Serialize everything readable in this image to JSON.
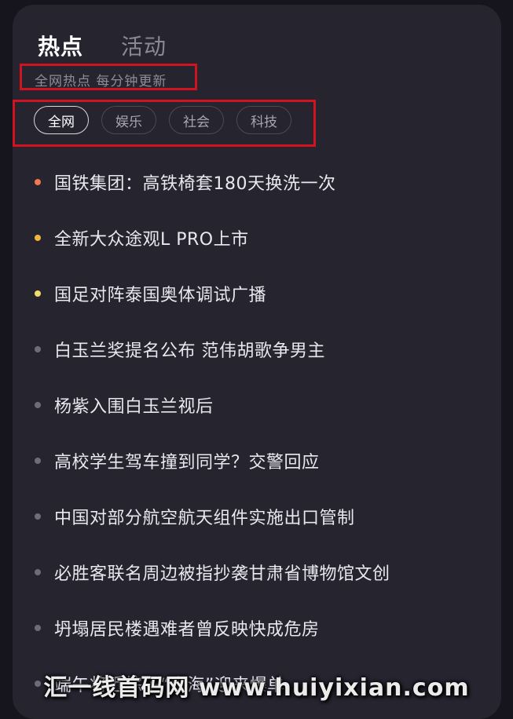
{
  "tabs": [
    {
      "label": "热点",
      "active": true
    },
    {
      "label": "活动",
      "active": false
    }
  ],
  "subtitle": "全网热点 每分钟更新",
  "chips": [
    {
      "label": "全网",
      "active": true
    },
    {
      "label": "娱乐",
      "active": false
    },
    {
      "label": "社会",
      "active": false
    },
    {
      "label": "科技",
      "active": false
    }
  ],
  "items": [
    {
      "text": "国铁集团：高铁椅套180天换洗一次",
      "dot_color": "#ef7a4f"
    },
    {
      "text": "全新大众途观L PRO上市",
      "dot_color": "#f2b33a"
    },
    {
      "text": "国足对阵泰国奥体调试广播",
      "dot_color": "#f1dc6a"
    },
    {
      "text": "白玉兰奖提名公布 范伟胡歌争男主",
      "dot_color": "#6e6c78"
    },
    {
      "text": "杨紫入围白玉兰视后",
      "dot_color": "#6e6c78"
    },
    {
      "text": "高校学生驾车撞到同学？交警回应",
      "dot_color": "#6e6c78"
    },
    {
      "text": "中国对部分航空航天组件实施出口管制",
      "dot_color": "#6e6c78"
    },
    {
      "text": "必胜客联名周边被指抄袭甘肃省博物馆文创",
      "dot_color": "#6e6c78"
    },
    {
      "text": "坍塌居民楼遇难者曾反映快成危房",
      "dot_color": "#6e6c78"
    },
    {
      "text": "端午将近粽子“出海”迎来爆单",
      "dot_color": "#6e6c78"
    }
  ],
  "watermark": "汇一线首码网 www.huiyixian.com"
}
